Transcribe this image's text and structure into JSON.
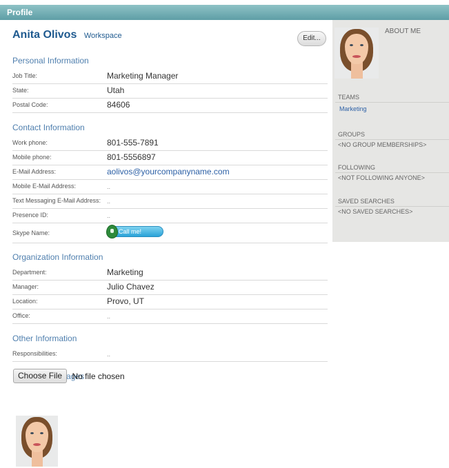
{
  "header": {
    "title": "Profile"
  },
  "user": {
    "name": "Anita Olivos",
    "workspace_link": "Workspace"
  },
  "edit_label": "Edit...",
  "sections": {
    "personal": {
      "title": "Personal Information",
      "fields": [
        {
          "label": "Job Title:",
          "value": "Marketing Manager"
        },
        {
          "label": "State:",
          "value": "Utah"
        },
        {
          "label": "Postal Code:",
          "value": "84606"
        }
      ]
    },
    "contact": {
      "title": "Contact Information",
      "fields": [
        {
          "label": "Work phone:",
          "value": "801-555-7891"
        },
        {
          "label": "Mobile phone:",
          "value": "801-5556897"
        },
        {
          "label": "E-Mail Address:",
          "value": "aolivos@yourcompanyname.com"
        },
        {
          "label": "Mobile E-Mail Address:",
          "value": ".."
        },
        {
          "label": "Text Messaging E-Mail Address:",
          "value": ".."
        },
        {
          "label": "Presence ID:",
          "value": ".."
        },
        {
          "label": "Skype Name:",
          "button_label": "Call me!"
        }
      ]
    },
    "organization": {
      "title": "Organization Information",
      "fields": [
        {
          "label": "Department:",
          "value": "Marketing"
        },
        {
          "label": "Manager:",
          "value": "Julio Chavez"
        },
        {
          "label": "Location:",
          "value": "Provo, UT"
        },
        {
          "label": "Office:",
          "value": ".."
        }
      ]
    },
    "other": {
      "title": "Other Information",
      "fields": [
        {
          "label": "Responsibilities:",
          "value": ".."
        }
      ]
    },
    "photos": {
      "title": "Photos And Images",
      "choose_file_label": "Choose File",
      "no_file_text": "No file chosen"
    }
  },
  "sidebar": {
    "about_me": "ABOUT ME",
    "teams": {
      "heading": "TEAMS",
      "items": [
        "Marketing"
      ]
    },
    "groups": {
      "heading": "GROUPS",
      "empty": "<NO GROUP MEMBERSHIPS>"
    },
    "following": {
      "heading": "FOLLOWING",
      "empty": "<NOT FOLLOWING ANYONE>"
    },
    "saved_searches": {
      "heading": "SAVED SEARCHES",
      "empty": "<NO SAVED SEARCHES>"
    }
  },
  "colors": {
    "header_bar": "#6aa8ae",
    "name_blue": "#1f5a8f",
    "section_title": "#4f7fae",
    "link": "#2b5fa5",
    "sidebar_bg": "#e6e6e4"
  }
}
